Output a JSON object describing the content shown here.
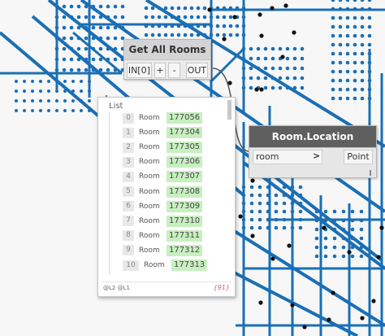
{
  "colors": {
    "geometry": "#1a6fb5",
    "point": "#111111",
    "value_bg": "#c8efc0"
  },
  "node_get_all_rooms": {
    "title": "Get All Rooms",
    "in_port": "IN[0]",
    "add_label": "+",
    "remove_label": "-",
    "out_port": "OUT"
  },
  "node_room_location": {
    "title": "Room.Location",
    "in_port": "room",
    "chevron": ">",
    "out_port": "Point"
  },
  "preview": {
    "title": "List",
    "items": [
      {
        "index": "0",
        "label": "Room",
        "value": "177056"
      },
      {
        "index": "1",
        "label": "Room",
        "value": "177304"
      },
      {
        "index": "2",
        "label": "Room",
        "value": "177305"
      },
      {
        "index": "3",
        "label": "Room",
        "value": "177306"
      },
      {
        "index": "4",
        "label": "Room",
        "value": "177307"
      },
      {
        "index": "5",
        "label": "Room",
        "value": "177308"
      },
      {
        "index": "6",
        "label": "Room",
        "value": "177309"
      },
      {
        "index": "7",
        "label": "Room",
        "value": "177310"
      },
      {
        "index": "8",
        "label": "Room",
        "value": "177311"
      },
      {
        "index": "9",
        "label": "Room",
        "value": "177312"
      },
      {
        "index": "10",
        "label": "Room",
        "value": "177313"
      }
    ],
    "levels": "@L2 @L1",
    "count": "{91}"
  }
}
